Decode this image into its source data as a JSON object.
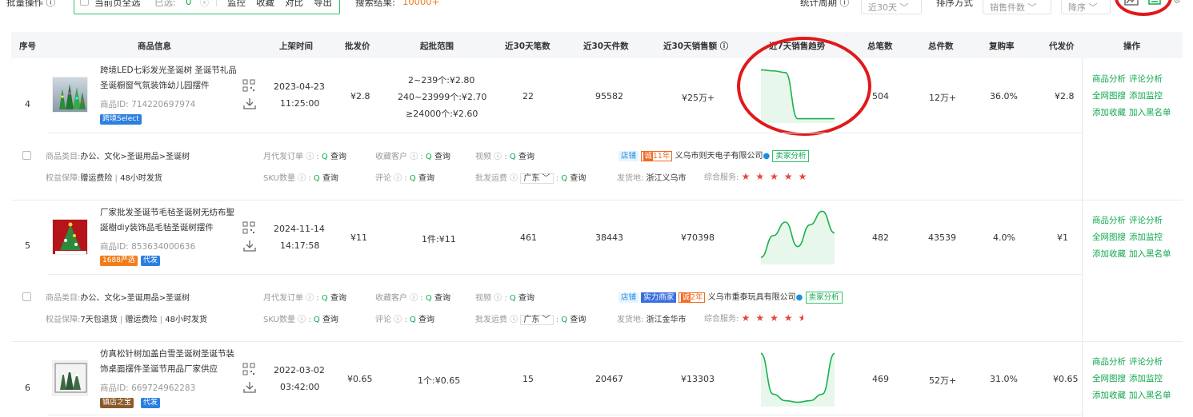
{
  "toolbar": {
    "batch_label": "批量操作 ⓘ",
    "select_all": "当前页全选",
    "selected_label": "已选:",
    "selected_count": "0",
    "monitor": "监控",
    "favorite": "收藏",
    "compare": "对比",
    "export": "导出",
    "result_label": "搜索结果:",
    "result_count": "10000+",
    "period_label": "统计周期 ⓘ",
    "period_value": "近30天",
    "sort_label": "排序方式",
    "sort_value": "销售件数",
    "order_value": "降序"
  },
  "columns": {
    "index": "序号",
    "info": "商品信息",
    "listed": "上架时间",
    "wholesale": "批发价",
    "range": "起批范围",
    "orders30": "近30天笔数",
    "pieces30": "近30天件数",
    "sales30": "近30天销售额 ⓘ",
    "trend7": "近7天销售趋势",
    "total_orders": "总笔数",
    "total_pieces": "总件数",
    "repurchase": "复购率",
    "dropship": "代发价",
    "actions": "操作"
  },
  "actions": {
    "a1": "商品分析",
    "a2": "评论分析",
    "a3": "全网图搜",
    "a4": "添加监控",
    "a5": "添加收藏",
    "a6": "加入黑名单"
  },
  "labels": {
    "category": "商品类目:",
    "guarantee": "权益保障:",
    "monthly_orders": "月代发订单 ⓘ :",
    "fav_customers": "收藏客户 ⓘ :",
    "video": "视频 ⓘ :",
    "sku": "SKU数量 ⓘ :",
    "review": "评论 ⓘ :",
    "shipping": "批发运费 ⓘ",
    "province": "广东",
    "origin": "发货地:",
    "service": "综合服务:",
    "query": "查询",
    "shop": "店铺",
    "seller_analysis": "卖家分析",
    "id_prefix": "商品ID:"
  },
  "products": [
    {
      "index": "4",
      "title": "跨境LED七彩发光圣诞树 圣诞节礼品 圣诞橱窗气氛装饰幼儿园摆件",
      "id": "714220697974",
      "tags": [
        {
          "text": "跨境Select",
          "color": "#2b7fe0"
        }
      ],
      "listed_date": "2023-04-23",
      "listed_time": "11:25:00",
      "wholesale": "¥2.8",
      "range": [
        "2~239个:¥2.80",
        "240~23999个:¥2.70",
        "≥24000个:¥2.60"
      ],
      "orders30": "22",
      "pieces30": "95582",
      "sales30": "¥25万+",
      "trend": [
        0.95,
        0.93,
        0.9,
        0.05,
        0.05,
        0.05,
        0.05
      ],
      "total_orders": "504",
      "total_pieces": "12万+",
      "repurchase": "36.0%",
      "dropship": "¥2.8",
      "category": "办公、文化>圣诞用品>圣诞树",
      "guarantee": [
        "赠运费险",
        "48小时发货"
      ],
      "shop_badges": [],
      "years": "11年",
      "shop_name": "义乌市则天电子有限公司",
      "origin": "浙江义乌市",
      "stars": 5
    },
    {
      "index": "5",
      "title": "厂家批发圣诞节毛毡圣诞树无纺布聖誕樹diy装饰品毛毡圣诞树摆件",
      "id": "853634000636",
      "tags": [
        {
          "text": "1688严选",
          "color": "#f07d1c"
        },
        {
          "text": "代发",
          "color": "#2b7fe0"
        }
      ],
      "listed_date": "2024-11-14",
      "listed_time": "14:17:58",
      "wholesale": "¥11",
      "range": [
        "1件:¥11"
      ],
      "orders30": "461",
      "pieces30": "38443",
      "sales30": "¥70398",
      "trend": [
        0.1,
        0.5,
        0.75,
        0.3,
        0.7,
        0.95,
        0.55
      ],
      "total_orders": "482",
      "total_pieces": "43539",
      "repurchase": "4.0%",
      "dropship": "¥1",
      "category": "办公、文化>圣诞用品>圣诞树",
      "guarantee": [
        "7天包退货",
        "赠运费险",
        "48小时发货"
      ],
      "shop_badges": [
        "实力商家"
      ],
      "years": "2年",
      "shop_name": "义乌市重泰玩具有限公司",
      "origin": "浙江金华市",
      "stars": 4.5
    },
    {
      "index": "6",
      "title": "仿真松针树加盖白雪圣诞树圣诞节装饰桌面摆件圣诞节用品厂家供应",
      "id": "669724962283",
      "tags": [
        {
          "text": "镇店之宝",
          "color": "#8a5a2b"
        },
        {
          "text": "代发",
          "color": "#2b7fe0"
        }
      ],
      "listed_date": "2022-03-02",
      "listed_time": "03:42:00",
      "wholesale": "¥0.65",
      "range": [
        "1个:¥0.65"
      ],
      "orders30": "15",
      "pieces30": "20467",
      "sales30": "¥13303",
      "trend": [
        0.95,
        0.2,
        0.08,
        0.05,
        0.08,
        0.2,
        0.95
      ],
      "total_orders": "469",
      "total_pieces": "52万+",
      "repurchase": "31.0%",
      "dropship": "¥0.65"
    }
  ],
  "colors": {
    "accent": "#12a84f",
    "highlight": "#e0191b",
    "orange": "#f07d1c",
    "trend_fill": "#e8f7ec"
  }
}
